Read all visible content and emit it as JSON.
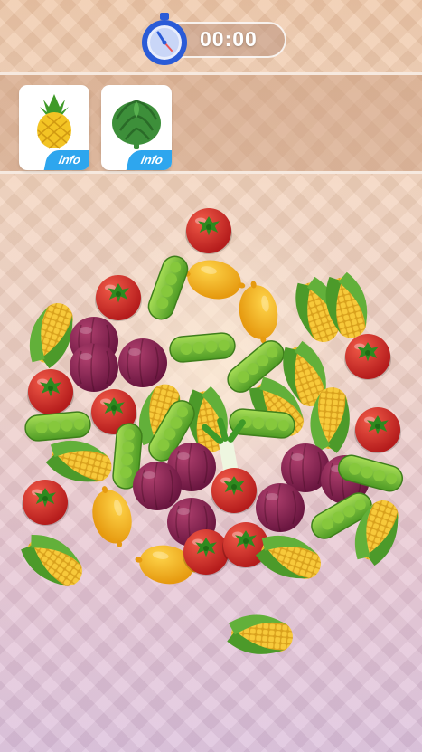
{
  "timer": {
    "value": "00:00",
    "icon": "stopwatch-icon"
  },
  "goals": [
    {
      "item": "pineapple",
      "icon": "pineapple-icon",
      "info_label": "info"
    },
    {
      "item": "artichoke",
      "icon": "artichoke-icon",
      "info_label": "info"
    }
  ],
  "board": {
    "items": [
      {
        "type": "tomato"
      },
      {
        "type": "tomato"
      },
      {
        "type": "tomato"
      },
      {
        "type": "tomato"
      },
      {
        "type": "tomato"
      },
      {
        "type": "tomato"
      },
      {
        "type": "tomato"
      },
      {
        "type": "tomato"
      },
      {
        "type": "lemon"
      },
      {
        "type": "lemon"
      },
      {
        "type": "lemon"
      },
      {
        "type": "lemon"
      },
      {
        "type": "pea-pod"
      },
      {
        "type": "pea-pod"
      },
      {
        "type": "pea-pod"
      },
      {
        "type": "pea-pod"
      },
      {
        "type": "pea-pod"
      },
      {
        "type": "pea-pod"
      },
      {
        "type": "pea-pod"
      },
      {
        "type": "pea-pod"
      },
      {
        "type": "pea-pod"
      },
      {
        "type": "pea-pod"
      },
      {
        "type": "corn"
      },
      {
        "type": "corn"
      },
      {
        "type": "corn"
      },
      {
        "type": "corn"
      },
      {
        "type": "corn"
      },
      {
        "type": "corn"
      },
      {
        "type": "corn"
      },
      {
        "type": "corn"
      },
      {
        "type": "corn"
      },
      {
        "type": "corn"
      },
      {
        "type": "corn"
      },
      {
        "type": "red-onion"
      },
      {
        "type": "red-onion"
      },
      {
        "type": "red-onion"
      },
      {
        "type": "red-onion"
      },
      {
        "type": "red-onion"
      },
      {
        "type": "red-onion"
      },
      {
        "type": "red-onion"
      },
      {
        "type": "red-onion"
      },
      {
        "type": "red-onion"
      },
      {
        "type": "red-onion"
      },
      {
        "type": "leek"
      }
    ]
  }
}
